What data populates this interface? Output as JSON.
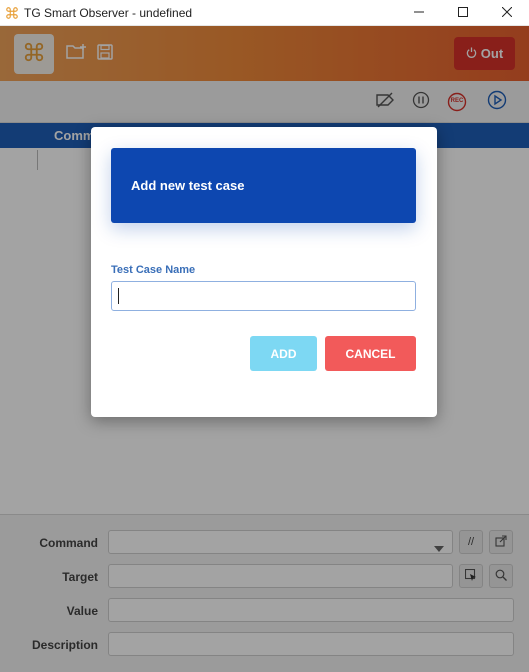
{
  "window": {
    "title": "TG Smart Observer - undefined",
    "icon": "cmd-icon",
    "controls": [
      "minimize-icon",
      "maximize-icon",
      "close-icon"
    ]
  },
  "header": {
    "logo_icon": "cmd-icon",
    "icons": [
      "new-folder-icon",
      "save-icon"
    ],
    "out_label": "Out",
    "out_icon": "power-icon"
  },
  "toolbar": {
    "icons": [
      "no-pause-icon",
      "pause-icon",
      "record-icon",
      "play-icon"
    ],
    "rec_label": "REC"
  },
  "table": {
    "column_label": "Comm"
  },
  "form": {
    "command_label": "Command",
    "target_label": "Target",
    "value_label": "Value",
    "description_label": "Description",
    "comment_button": "//"
  },
  "modal": {
    "title": "Add new test case",
    "field_label": "Test Case Name",
    "field_value": "",
    "add_label": "ADD",
    "cancel_label": "CANCEL"
  },
  "colors": {
    "header_gradient_start": "#f0a35a",
    "header_gradient_end": "#e8602e",
    "out_button": "#d6312a",
    "table_header": "#1f5fb8",
    "modal_header": "#0d47b0",
    "add_button": "#7dd8f3",
    "cancel_button": "#f25a5a"
  }
}
